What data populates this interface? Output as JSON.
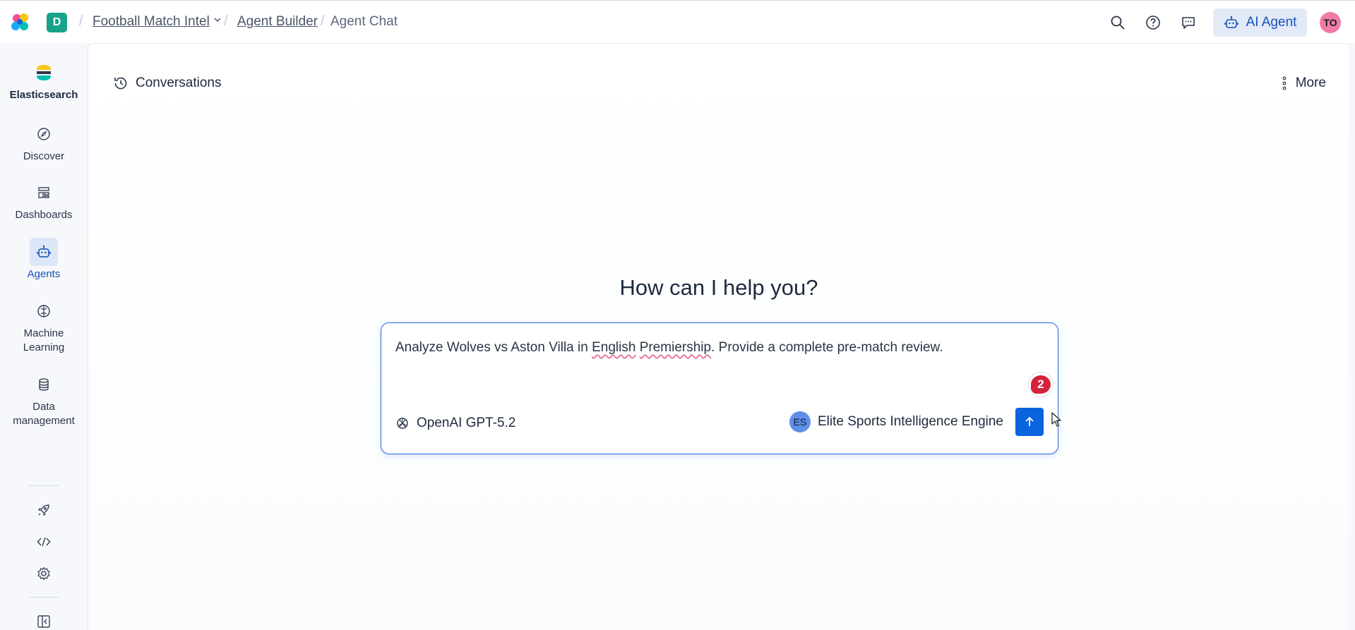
{
  "header": {
    "space_badge": "D",
    "breadcrumbs": [
      "Football Match Intel",
      "Agent Builder",
      "Agent Chat"
    ],
    "ai_agent_label": "AI Agent",
    "user_initials": "TO",
    "icons": [
      "search-icon",
      "help-icon",
      "feedback-icon",
      "robot-icon"
    ]
  },
  "sidebar": {
    "brand": "Elasticsearch",
    "items": [
      {
        "label": "Discover",
        "icon": "compass-icon"
      },
      {
        "label": "Dashboards",
        "icon": "dashboard-icon"
      },
      {
        "label": "Agents",
        "icon": "robot-icon",
        "active": true
      },
      {
        "label": "Machine Learning",
        "icon": "ml-icon"
      },
      {
        "label": "Data management",
        "icon": "database-icon"
      }
    ],
    "bottom_icons": [
      "rocket-icon",
      "code-icon",
      "gear-icon",
      "collapse-icon"
    ]
  },
  "main": {
    "conversations_label": "Conversations",
    "more_label": "More",
    "title": "How can I help you?",
    "composer": {
      "prompt_pre": "Analyze Wolves vs Aston Villa in ",
      "prompt_word1": "English",
      "prompt_space": " ",
      "prompt_word2": "Premiership",
      "prompt_post": ". Provide a complete pre-match review.",
      "notification_count": "2",
      "model_label": "OpenAI GPT-5.2",
      "agent_initials": "ES",
      "agent_label": "Elite Sports Intelligence Engine"
    }
  },
  "colors": {
    "accent": "#0b64dd",
    "space_badge": "#16a38a",
    "avatar": "#f07ca7",
    "notification": "#d6213a"
  }
}
